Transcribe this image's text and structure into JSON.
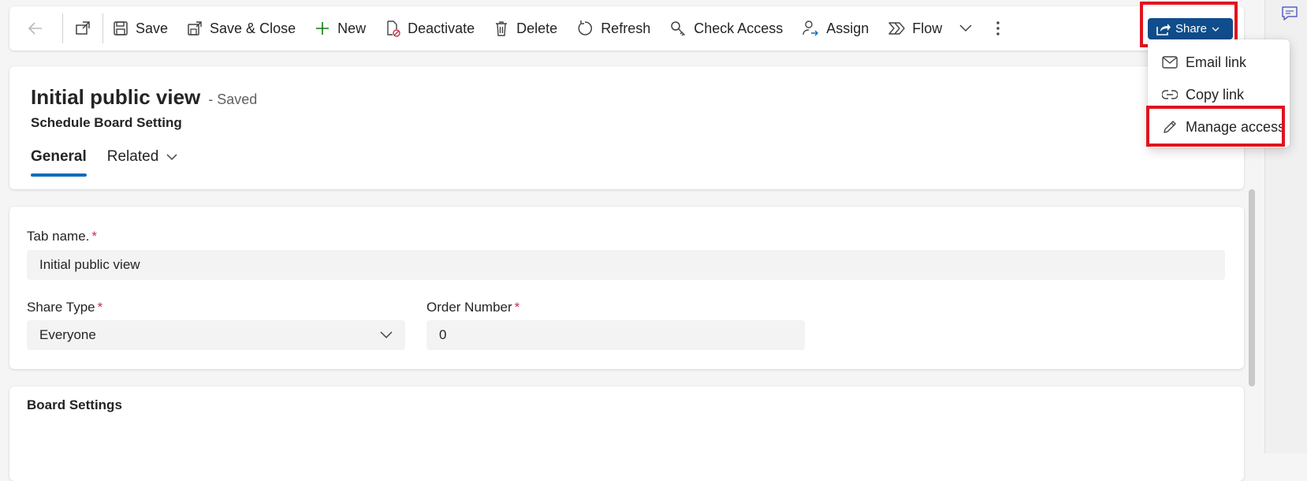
{
  "commandbar": {
    "save": "Save",
    "save_close": "Save & Close",
    "new": "New",
    "deactivate": "Deactivate",
    "delete": "Delete",
    "refresh": "Refresh",
    "check_access": "Check Access",
    "assign": "Assign",
    "flow": "Flow",
    "share": "Share"
  },
  "share_menu": {
    "items": [
      {
        "label": "Email link",
        "icon": "mail-icon"
      },
      {
        "label": "Copy link",
        "icon": "link-icon"
      },
      {
        "label": "Manage access",
        "icon": "pencil-icon"
      }
    ]
  },
  "header": {
    "title": "Initial public view",
    "status": "- Saved",
    "entity": "Schedule Board Setting",
    "tabs": [
      "General",
      "Related"
    ]
  },
  "form": {
    "tab_name_label": "Tab name.",
    "tab_name_value": "Initial public view",
    "share_type_label": "Share Type",
    "share_type_value": "Everyone",
    "order_number_label": "Order Number",
    "order_number_value": "0",
    "required_marker": "*"
  },
  "board_settings": {
    "title": "Board Settings"
  },
  "colors": {
    "accent": "#0f4d8c",
    "tab_underline": "#0f6cbd",
    "highlight": "#e0141e"
  }
}
